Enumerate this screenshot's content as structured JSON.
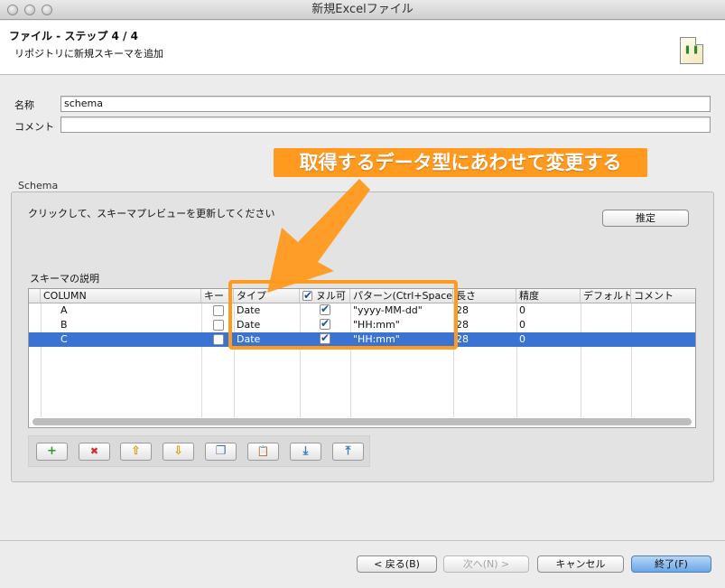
{
  "window": {
    "title": "新規Excelファイル"
  },
  "header": {
    "title": "ファイル - ステップ 4 /  4",
    "description": "リポジトリに新規スキーマを追加"
  },
  "form": {
    "name_label": "名称",
    "name_value": "schema",
    "comment_label": "コメント",
    "comment_value": ""
  },
  "schema": {
    "legend": "Schema",
    "refresh_hint": "クリックして、スキーマプレビューを更新してください",
    "guess_button": "推定",
    "description_label": "スキーマの説明",
    "columns": [
      "COLUMN",
      "キー",
      "タイプ",
      "ヌル可",
      "パターン(Ctrl+Space",
      "長さ",
      "精度",
      "デフォルト",
      "コメント"
    ],
    "rows": [
      {
        "column": "A",
        "key": false,
        "type": "Date",
        "nullable": true,
        "pattern": "\"yyyy-MM-dd\"",
        "length": "28",
        "precision": "0",
        "default": "",
        "comment": "",
        "selected": false
      },
      {
        "column": "B",
        "key": false,
        "type": "Date",
        "nullable": true,
        "pattern": "\"HH:mm\"",
        "length": "28",
        "precision": "0",
        "default": "",
        "comment": "",
        "selected": false
      },
      {
        "column": "C",
        "key": false,
        "type": "Date",
        "nullable": true,
        "pattern": "\"HH:mm\"",
        "length": "28",
        "precision": "0",
        "default": "",
        "comment": "",
        "selected": true
      }
    ],
    "toolbar": [
      {
        "icon": "add-icon",
        "glyph": "+"
      },
      {
        "icon": "remove-icon",
        "glyph": "✖"
      },
      {
        "icon": "move-up-icon",
        "glyph": "⇧"
      },
      {
        "icon": "move-down-icon",
        "glyph": "⇩"
      },
      {
        "icon": "copy-icon",
        "glyph": "❐"
      },
      {
        "icon": "paste-icon",
        "glyph": "📋"
      },
      {
        "icon": "import-icon",
        "glyph": "⤓"
      },
      {
        "icon": "export-icon",
        "glyph": "⤒"
      }
    ]
  },
  "annotation": {
    "text": "取得するデータ型にあわせて変更する",
    "color": "#ff9a1f"
  },
  "footer": {
    "back": "< 戻る(B)",
    "next": "次へ(N) >",
    "cancel": "キャンセル",
    "finish": "終了(F)"
  }
}
